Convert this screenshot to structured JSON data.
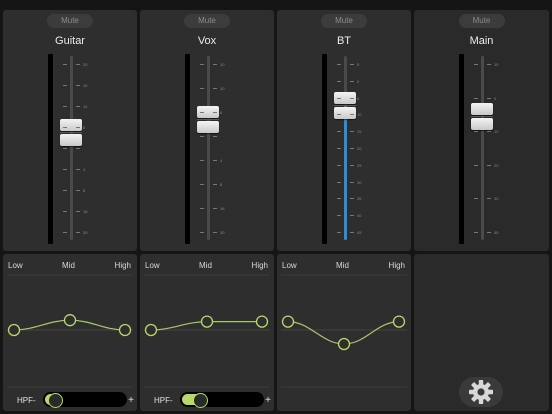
{
  "channels": [
    {
      "name": "Guitar",
      "mute_label": "Mute",
      "fader_level": 0.58,
      "fill_color": "",
      "scale": [
        "20",
        "10",
        "14",
        "6",
        "",
        "4",
        "8",
        "16",
        "30"
      ]
    },
    {
      "name": "Vox",
      "mute_label": "Mute",
      "fader_level": 0.65,
      "fill_color": "",
      "scale": [
        "10",
        "10",
        "6",
        "",
        "4",
        "8",
        "16",
        "30"
      ]
    },
    {
      "name": "BT",
      "mute_label": "Mute",
      "fader_level": 0.73,
      "fill_color": "#2a8fd8",
      "scale": [
        "5",
        "0",
        "5",
        "10",
        "15",
        "20",
        "25",
        "30",
        "35",
        "40",
        "45"
      ]
    },
    {
      "name": "Main",
      "mute_label": "Mute",
      "fader_level": 0.67,
      "fill_color": "",
      "scale": [
        "10",
        "0",
        "10",
        "20",
        "30",
        "40"
      ]
    }
  ],
  "eq": {
    "low_label": "Low",
    "mid_label": "Mid",
    "high_label": "High",
    "bands": [
      {
        "low": 0.0,
        "mid": 0.35,
        "high": 0.0
      },
      {
        "low": 0.0,
        "mid": 0.3,
        "high": 0.3
      },
      {
        "low": 0.3,
        "mid": -0.5,
        "high": 0.3
      }
    ]
  },
  "hpf": {
    "label": "HPF-",
    "plus": "+"
  },
  "settings": {
    "icon": "gear-icon"
  },
  "colors": {
    "eq_line": "#a9c66a",
    "eq_node_fill": "#2e2e2e",
    "eq_node_stroke": "#b7d86a",
    "meter_fill": "#2a8fd8"
  }
}
